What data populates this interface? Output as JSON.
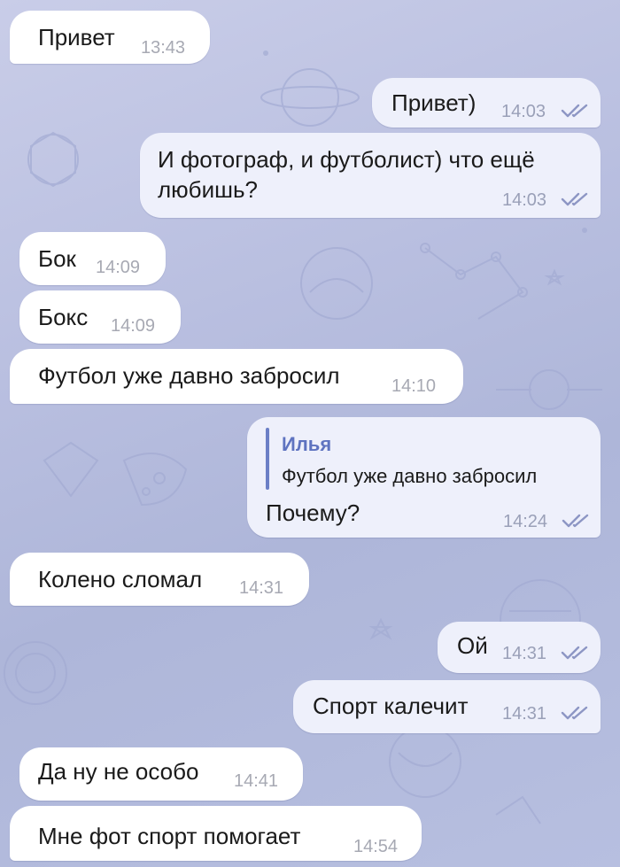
{
  "chat": {
    "messages": [
      {
        "direction": "in",
        "text": "Привет",
        "time": "13:43"
      },
      {
        "direction": "out",
        "text": "Привет)",
        "time": "14:03",
        "read": true
      },
      {
        "direction": "out",
        "text_lines": [
          "И фотограф, и футболист) что ещё",
          "любишь?"
        ],
        "time": "14:03",
        "read": true
      },
      {
        "direction": "in",
        "text": "Бок",
        "time": "14:09"
      },
      {
        "direction": "in",
        "text": "Бокс",
        "time": "14:09"
      },
      {
        "direction": "in",
        "text": "Футбол уже давно забросил",
        "time": "14:10"
      },
      {
        "direction": "out",
        "reply": {
          "name": "Илья",
          "text": "Футбол уже давно забросил"
        },
        "text": "Почему?",
        "time": "14:24",
        "read": true
      },
      {
        "direction": "in",
        "text": "Колено сломал",
        "time": "14:31"
      },
      {
        "direction": "out",
        "text": "Ой",
        "time": "14:31",
        "read": true
      },
      {
        "direction": "out",
        "text": "Спорт калечит",
        "time": "14:31",
        "read": true
      },
      {
        "direction": "in",
        "text": "Да ну не особо",
        "time": "14:41"
      },
      {
        "direction": "in",
        "text": "Мне фот спорт помогает",
        "time": "14:54"
      }
    ]
  },
  "icons": {
    "read_receipt": "double-check-icon",
    "background": "space-doodle-pattern"
  },
  "colors": {
    "incoming_bubble": "#ffffff",
    "outgoing_bubble": "#eef0fb",
    "check": "#8d96c4",
    "reply_accent": "#5e73c0"
  }
}
